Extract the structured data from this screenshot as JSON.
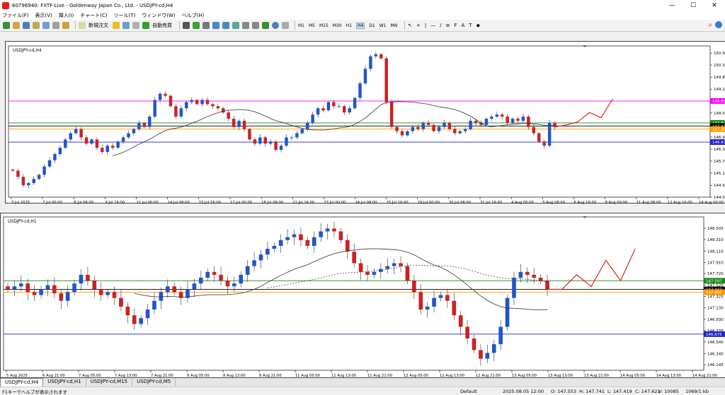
{
  "window": {
    "title": "60796940: FXTF-Live - Goldenway Japan Co., Ltd. - USDJPY-cd,H4",
    "controls": [
      "—",
      "☐",
      "✕"
    ]
  },
  "menu": [
    "ファイル(F)",
    "表示(V)",
    "挿入(I)",
    "チャート(C)",
    "ツール(T)",
    "ウィンドウ(W)",
    "ヘルプ(H)"
  ],
  "toolbar": {
    "new_order": "新規注文",
    "auto_trade": "自動売買",
    "timeframes": [
      "M1",
      "M5",
      "M15",
      "M30",
      "H1",
      "H4",
      "D1",
      "W1",
      "MN"
    ],
    "active_timeframe": "H4"
  },
  "tabs": [
    "USDJPY-cd,H4",
    "USDJPY-cd,H1",
    "USDJPY-cd,M15",
    "USDJPY-cd,M5"
  ],
  "active_tab": 0,
  "status": {
    "help": "F1キーでヘルプが表示されます",
    "profile": "Default",
    "datetime": "2025.08.05 12:00",
    "o": "O: 147.553",
    "h": "H: 147.741",
    "l": "L: 147.419",
    "c": "C: 147.621",
    "v": "V: 10085",
    "traffic": "1069/1 kb"
  },
  "chart_data": [
    {
      "type": "candlestick",
      "title": "USDJPY-cd,H4",
      "ylim": [
        144.025,
        151.3
      ],
      "y_ticks": [
        150.955,
        150.38,
        149.8,
        149.22,
        148.64,
        148.075,
        147.49,
        146.915,
        146.335,
        145.76,
        145.18,
        144.595,
        144.025
      ],
      "x_ticks": [
        "3 Jul 2025",
        "7 Jul 00:00",
        "8 Jul 08:00",
        "9 Jul 16:00",
        "11 Jul 00:00",
        "14 Jul 08:00",
        "15 Jul 16:00",
        "17 Jul 00:00",
        "18 Jul 08:00",
        "21 Jul 16:00",
        "23 Jul 00:00",
        "24 Jul 08:00",
        "25 Jul 16:00",
        "29 Jul 00:00",
        "30 Jul 08:00",
        "31 Jul 16:00",
        "4 Aug 00:00",
        "5 Aug 08:00",
        "6 Aug 16:00",
        "8 Aug 00:00",
        "11 Aug 08:00",
        "12 Aug 16:00",
        "14 Aug 00:00"
      ],
      "hlines": [
        {
          "value": 148.65,
          "label": "148.650",
          "color": "#ff00ff"
        },
        {
          "value": 147.597,
          "label": "147.597",
          "color": "#1a8a1a"
        },
        {
          "value": 147.447,
          "label": "147.447",
          "color": "#000000"
        },
        {
          "value": 147.3,
          "label": "147.300",
          "color": "#ff9900"
        },
        {
          "value": 146.675,
          "label": "146.675",
          "color": "#2222cc"
        }
      ],
      "closes": [
        145.3,
        145.0,
        144.6,
        144.7,
        144.9,
        145.1,
        145.5,
        145.8,
        146.1,
        146.4,
        146.8,
        147.1,
        147.3,
        146.9,
        146.6,
        146.8,
        146.4,
        146.2,
        146.5,
        146.4,
        146.7,
        146.9,
        147.1,
        147.3,
        147.6,
        147.4,
        147.9,
        148.7,
        149.0,
        148.9,
        148.4,
        147.9,
        148.3,
        148.6,
        148.7,
        148.5,
        148.7,
        148.5,
        148.4,
        148.3,
        148.1,
        147.8,
        147.4,
        147.7,
        147.3,
        146.8,
        146.6,
        146.9,
        146.6,
        146.7,
        146.3,
        146.5,
        146.9,
        146.9,
        147.1,
        147.3,
        147.6,
        148.0,
        148.3,
        148.2,
        148.6,
        148.4,
        148.4,
        148.1,
        148.3,
        148.8,
        149.5,
        150.2,
        150.8,
        150.9,
        150.7,
        148.6,
        147.4,
        147.2,
        147.0,
        147.2,
        147.4,
        147.3,
        147.6,
        147.5,
        147.2,
        147.4,
        147.6,
        147.3,
        147.1,
        147.2,
        147.3,
        147.7,
        147.6,
        147.5,
        147.8,
        147.9,
        148.0,
        147.9,
        147.6,
        147.8,
        147.7,
        147.9,
        147.4,
        147.1,
        146.7,
        146.5,
        147.6,
        147.4
      ],
      "forecast": [
        147.5,
        147.65,
        148.1,
        147.85,
        148.75
      ]
    },
    {
      "type": "candlestick",
      "title": "USDJPY-cd,H1",
      "ylim": [
        146.05,
        148.7
      ],
      "y_ticks": [
        148.505,
        148.31,
        148.11,
        147.91,
        147.72,
        147.52,
        147.325,
        147.13,
        146.93,
        146.735,
        146.54,
        146.34,
        146.145
      ],
      "x_ticks": [
        "5 Aug 2025",
        "6 Aug 21:00",
        "7 Aug 05:00",
        "7 Aug 13:00",
        "7 Aug 21:00",
        "8 Aug 05:00",
        "8 Aug 13:00",
        "8 Aug 21:00",
        "11 Aug 05:00",
        "11 Aug 13:00",
        "11 Aug 21:00",
        "12 Aug 05:00",
        "12 Aug 13:00",
        "12 Aug 21:00",
        "13 Aug 05:00",
        "13 Aug 13:00",
        "13 Aug 21:00",
        "14 Aug 05:00",
        "14 Aug 13:00",
        "14 Aug 21:00"
      ],
      "hlines": [
        {
          "value": 147.597,
          "label": "147.597",
          "color": "#1a8a1a"
        },
        {
          "value": 147.447,
          "label": "147.447",
          "color": "#000000"
        },
        {
          "value": 147.4,
          "label": "147.400",
          "color": "#ff9900"
        },
        {
          "value": 146.675,
          "label": "146.675",
          "color": "#2222cc"
        }
      ],
      "closes": [
        147.45,
        147.5,
        147.55,
        147.4,
        147.35,
        147.45,
        147.52,
        147.38,
        147.25,
        147.4,
        147.55,
        147.7,
        147.6,
        147.45,
        147.35,
        147.4,
        147.3,
        147.15,
        147.0,
        146.85,
        146.95,
        147.1,
        147.25,
        147.4,
        147.5,
        147.4,
        147.3,
        147.45,
        147.55,
        147.65,
        147.75,
        147.7,
        147.6,
        147.5,
        147.55,
        147.7,
        147.85,
        147.95,
        148.05,
        148.15,
        148.2,
        148.3,
        148.35,
        148.4,
        148.3,
        148.2,
        148.35,
        148.45,
        148.5,
        148.45,
        148.3,
        148.1,
        147.9,
        147.75,
        147.7,
        147.75,
        147.8,
        147.85,
        147.9,
        147.85,
        147.6,
        147.4,
        147.1,
        147.15,
        147.3,
        147.35,
        147.25,
        147.0,
        146.8,
        146.6,
        146.4,
        146.25,
        146.35,
        146.5,
        146.8,
        147.3,
        147.65,
        147.75,
        147.7,
        147.65,
        147.6,
        147.45
      ],
      "forecast": [
        147.45,
        147.7,
        147.5,
        147.95,
        147.6,
        148.15
      ]
    }
  ]
}
